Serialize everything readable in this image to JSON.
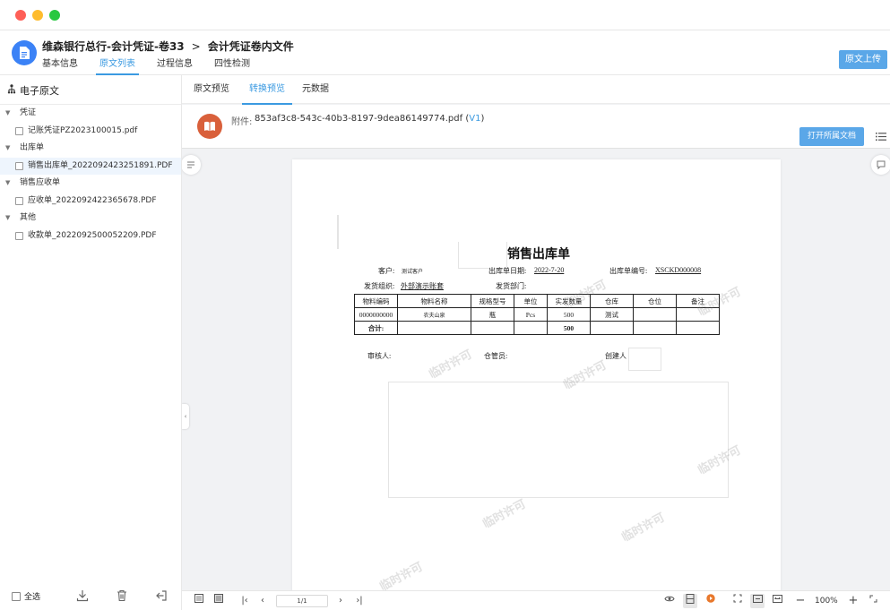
{
  "header": {
    "breadcrumb_parent": "维森银行总行-会计凭证-卷33",
    "breadcrumb_sep": ">",
    "breadcrumb_current": "会计凭证卷内文件",
    "tabs": [
      {
        "label": "基本信息"
      },
      {
        "label": "原文列表"
      },
      {
        "label": "过程信息"
      },
      {
        "label": "四性检测"
      }
    ],
    "active_tab": "原文列表",
    "upload_button": "原文上传"
  },
  "sidebar": {
    "title": "电子原文",
    "groups": [
      {
        "label": "凭证",
        "files": [
          "记账凭证PZ2023100015.pdf"
        ]
      },
      {
        "label": "出库单",
        "files": [
          "销售出库单_2022092423251891.PDF"
        ]
      },
      {
        "label": "销售应收单",
        "files": [
          "应收单_2022092422365678.PDF"
        ]
      },
      {
        "label": "其他",
        "files": [
          "收款单_2022092500052209.PDF"
        ]
      }
    ],
    "selected_file": "销售出库单_2022092423251891.PDF",
    "select_all": "全选"
  },
  "main": {
    "tabs": [
      {
        "label": "原文预览"
      },
      {
        "label": "转换预览"
      },
      {
        "label": "元数据"
      }
    ],
    "active_tab": "转换预览",
    "attachment_prefix": "附件:",
    "attachment_name": "853af3c8-543c-40b3-8197-9dea86149774.pdf",
    "version_open": " (",
    "version": "V1",
    "version_close": ")",
    "open_button": "打开所属文档"
  },
  "document": {
    "title": "销售出库单",
    "customer_label": "客户:",
    "customer_value": "测试客户",
    "date_label": "出库单日期:",
    "date_value": "2022-7-20",
    "number_label": "出库单编号:",
    "number_value": "XSCKD000008",
    "org_label": "发货组织:",
    "org_value": "外部演示账套",
    "dept_label": "发货部门:",
    "table": {
      "headers": [
        "物料编码",
        "物料名称",
        "规格型号",
        "单位",
        "实发数量",
        "仓库",
        "仓位",
        "备注"
      ],
      "rows": [
        [
          "0000000000",
          "农夫山泉",
          "瓶",
          "Pcs",
          "500",
          "测试",
          "",
          ""
        ]
      ],
      "total_label": "合计:",
      "total_qty": "500"
    },
    "reviewer_label": "审核人:",
    "keeper_label": "仓管员:",
    "creator_label": "创建人",
    "watermark": "临时许可"
  },
  "toolbar": {
    "page_value": "1/1",
    "zoom": "100%"
  },
  "colors": {
    "accent": "#3b9ae1",
    "button": "#5aa7e8",
    "attachment_icon": "#d9603b"
  }
}
